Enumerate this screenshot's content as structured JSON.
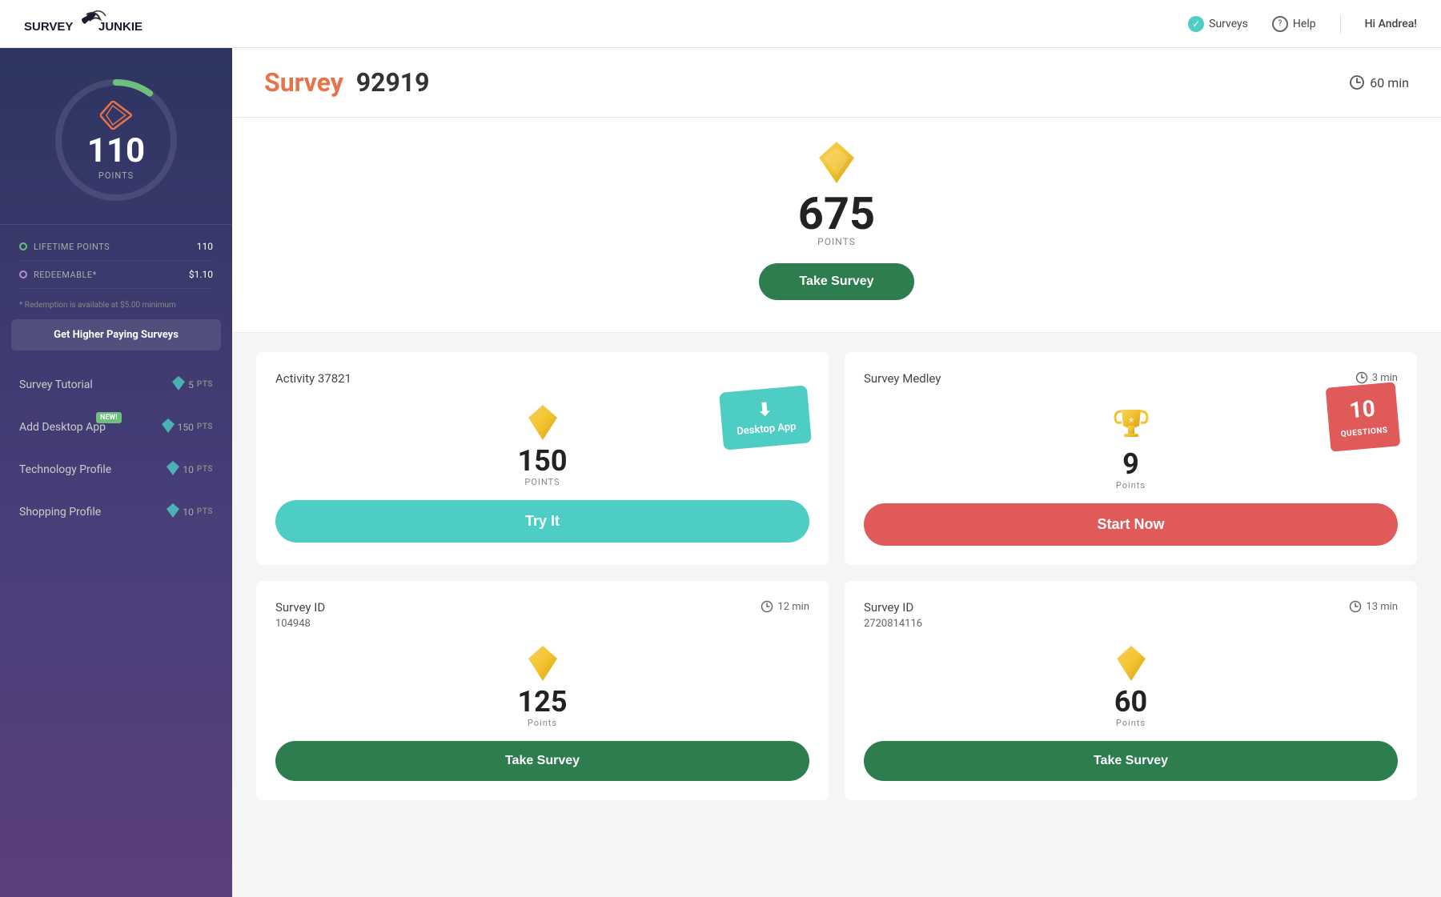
{
  "header": {
    "logo": "SURVEY JUNKIE",
    "logo_part1": "SURVEY",
    "logo_part2": "JUNKIE",
    "nav_surveys": "Surveys",
    "nav_help": "Help",
    "greeting": "Hi Andrea!"
  },
  "sidebar": {
    "points_num": "110",
    "points_label": "POINTS",
    "lifetime_label": "LIFETIME POINTS",
    "lifetime_value": "110",
    "redeemable_label": "REDEEMABLE*",
    "redeemable_value": "$1.10",
    "redemption_note": "* Redemption is available at $5.00 minimum",
    "get_higher": "Get Higher Paying Surveys",
    "nav_items": [
      {
        "label": "Survey Tutorial",
        "pts": "5",
        "pts_label": "PTS",
        "new": false
      },
      {
        "label": "Add Desktop App",
        "pts": "150",
        "pts_label": "PTS",
        "new": true
      },
      {
        "label": "Technology Profile",
        "pts": "10",
        "pts_label": "PTS",
        "new": false
      },
      {
        "label": "Shopping Profile",
        "pts": "10",
        "pts_label": "PTS",
        "new": false
      }
    ],
    "new_badge_text": "NEW!"
  },
  "survey_header": {
    "title_orange": "Survey",
    "title_dark": "92919",
    "time": "60 min"
  },
  "hero": {
    "points_num": "675",
    "points_label": "POINTS",
    "button_label": "Take Survey"
  },
  "cards": [
    {
      "id": "activity",
      "title": "Activity 37821",
      "time": null,
      "points_num": "150",
      "points_label": "POINTS",
      "button_label": "Try It",
      "button_type": "try",
      "badge_type": "desktop",
      "badge_text": "Desktop App"
    },
    {
      "id": "medley",
      "title": "Survey Medley",
      "time": "3 min",
      "points_num": "9",
      "points_label": "Points",
      "button_label": "Start Now",
      "button_type": "start",
      "badge_type": "questions",
      "badge_num": "10",
      "badge_label": "QUESTIONS"
    },
    {
      "id": "survey1",
      "title": "Survey ID",
      "subtitle": "104948",
      "time": "12 min",
      "points_num": "125",
      "points_label": "Points",
      "button_label": "Take Survey",
      "button_type": "take"
    },
    {
      "id": "survey2",
      "title": "Survey ID",
      "subtitle": "2720814116",
      "time": "13 min",
      "points_num": "60",
      "points_label": "Points",
      "button_label": "Take Survey",
      "button_type": "take"
    }
  ]
}
